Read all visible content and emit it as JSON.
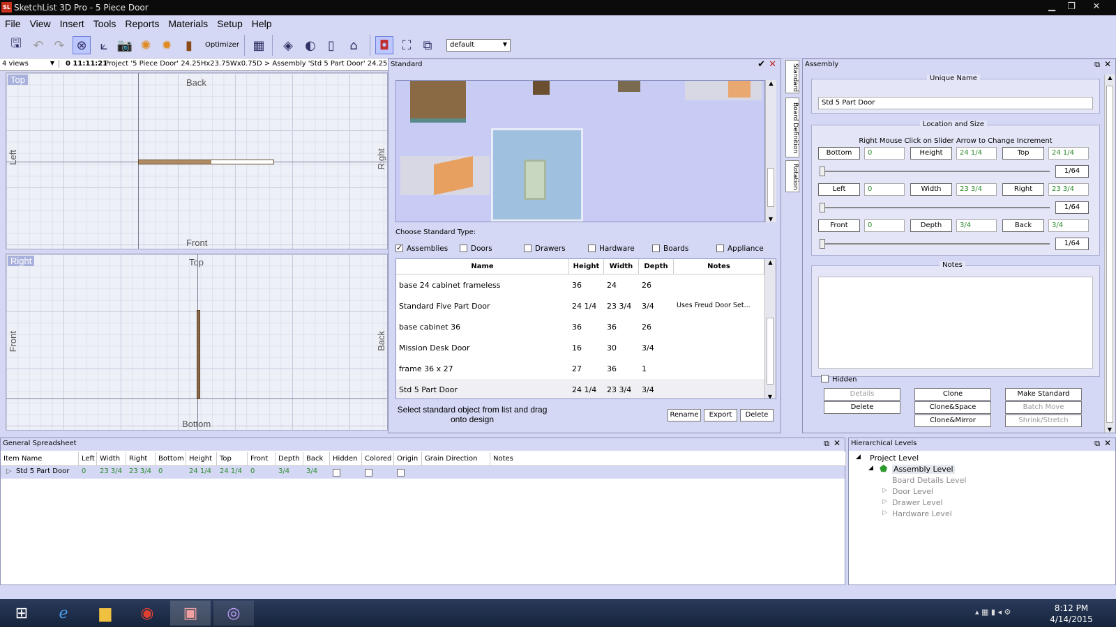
{
  "window": {
    "title": "SketchList 3D Pro - 5 Piece Door",
    "logo": "SL"
  },
  "menu": [
    "File",
    "View",
    "Insert",
    "Tools",
    "Reports",
    "Materials",
    "Setup",
    "Help"
  ],
  "toolbar": {
    "optimizer_label": "Optimizer",
    "view_preset": "default"
  },
  "views_bar": {
    "selector": "4 views",
    "clock": "0 11:11:21",
    "project_text": "Project '5 Piece Door' 24.25Hx23.75Wx0.75D > Assembly 'Std 5 Part Door' 24.25Hx23.75"
  },
  "top_view": {
    "tag": "Top",
    "back": "Back",
    "front": "Front",
    "left": "Left",
    "right": "Right"
  },
  "right_view": {
    "tag": "Right",
    "top": "Top",
    "bottom": "Bottom",
    "front": "Front",
    "back": "Back"
  },
  "standard": {
    "title": "Standard",
    "choose_label": "Choose Standard Type:",
    "types": [
      {
        "label": "Assemblies",
        "checked": true
      },
      {
        "label": "Doors",
        "checked": false
      },
      {
        "label": "Drawers",
        "checked": false
      },
      {
        "label": "Hardware",
        "checked": false
      },
      {
        "label": "Boards",
        "checked": false
      },
      {
        "label": "Appliance",
        "checked": false
      }
    ],
    "columns": [
      "Name",
      "Height",
      "Width",
      "Depth",
      "Notes"
    ],
    "rows": [
      {
        "name": "base 24 cabinet frameless",
        "height": "36",
        "width": "24",
        "depth": "26",
        "notes": ""
      },
      {
        "name": "Standard Five Part Door",
        "height": "24 1/4",
        "width": "23 3/4",
        "depth": "3/4",
        "notes": "Uses Freud Door Set..."
      },
      {
        "name": "base cabinet 36",
        "height": "36",
        "width": "36",
        "depth": "26",
        "notes": ""
      },
      {
        "name": "Mission Desk Door",
        "height": "16",
        "width": "30",
        "depth": "3/4",
        "notes": ""
      },
      {
        "name": "frame 36 x 27",
        "height": "27",
        "width": "36",
        "depth": "1",
        "notes": ""
      },
      {
        "name": "Std 5 Part Door",
        "height": "24 1/4",
        "width": "23 3/4",
        "depth": "3/4",
        "notes": ""
      }
    ],
    "hint": "Select standard object from list and drag onto design",
    "buttons": {
      "rename": "Rename",
      "export": "Export",
      "delete": "Delete"
    }
  },
  "side_tabs": [
    "Standard",
    "Board Definition",
    "Rotation"
  ],
  "assembly": {
    "title": "Assembly",
    "unique_name_label": "Unique Name",
    "unique_name": "Std 5 Part Door",
    "loc_label": "Location and Size",
    "loc_hint": "Right Mouse Click on Slider Arrow to Change Increment",
    "rows": [
      {
        "a_label": "Bottom",
        "a_val": "0",
        "b_label": "Height",
        "b_val": "24 1/4",
        "c_label": "Top",
        "c_val": "24 1/4",
        "inc": "1/64"
      },
      {
        "a_label": "Left",
        "a_val": "0",
        "b_label": "Width",
        "b_val": "23 3/4",
        "c_label": "Right",
        "c_val": "23 3/4",
        "inc": "1/64"
      },
      {
        "a_label": "Front",
        "a_val": "0",
        "b_label": "Depth",
        "b_val": "3/4",
        "c_label": "Back",
        "c_val": "3/4",
        "inc": "1/64"
      }
    ],
    "notes_label": "Notes",
    "hidden_label": "Hidden",
    "buttons": {
      "details": "Details",
      "delete": "Delete",
      "clone": "Clone",
      "clone_space": "Clone&Space",
      "clone_mirror": "Clone&Mirror",
      "make_standard": "Make Standard",
      "batch_move": "Batch Move",
      "shrink_stretch": "Shrink/Stretch"
    }
  },
  "spreadsheet": {
    "title": "General Spreadsheet",
    "columns": [
      "Item Name",
      "Left",
      "Width",
      "Right",
      "Bottom",
      "Height",
      "Top",
      "Front",
      "Depth",
      "Back",
      "Hidden",
      "Colored",
      "Origin",
      "Grain Direction",
      "Notes"
    ],
    "row": {
      "name": "Std 5 Part Door",
      "left": "0",
      "width": "23 3/4",
      "right": "23 3/4",
      "bottom": "0",
      "height": "24 1/4",
      "top": "24 1/4",
      "front": "0",
      "depth": "3/4",
      "back": "3/4"
    }
  },
  "hierarchy": {
    "title": "Hierarchical Levels",
    "nodes": [
      "Project Level",
      "Assembly Level",
      "Board Details Level",
      "Door Level",
      "Drawer Level",
      "Hardware Level"
    ]
  },
  "taskbar": {
    "time": "8:12 PM",
    "date": "4/14/2015"
  }
}
